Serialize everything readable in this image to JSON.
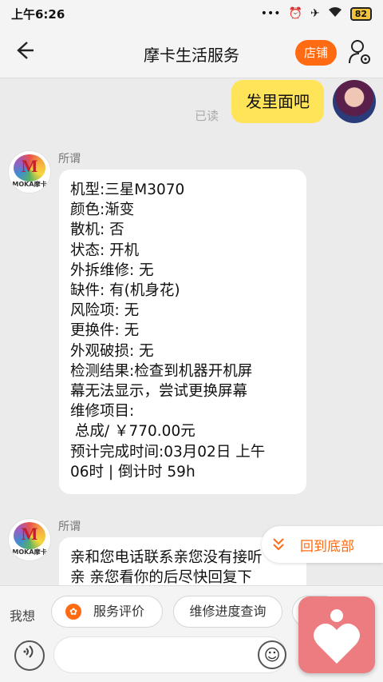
{
  "status_bar": {
    "time": "上午6:26",
    "icons": [
      "more-dots-icon",
      "alarm-icon",
      "airplane-icon",
      "wifi-icon"
    ],
    "battery": "82"
  },
  "header": {
    "back_icon": "back-arrow-icon",
    "title": "摩卡生活服务",
    "shop_button": "店铺",
    "user_icon": "user-settings-icon"
  },
  "chat": {
    "self_message": {
      "text": "发里面吧",
      "status": "已读"
    },
    "messages": [
      {
        "sender": "所谓",
        "avatar_text": "MOKA摩卡",
        "lines": [
          "机型:三星M3070",
          "颜色:渐变",
          "散机: 否",
          "状态: 开机",
          "外拆维修: 无",
          "缺件: 有(机身花)",
          "风险项: 无",
          "更换件: 无",
          "外观破损: 无",
          "检测结果:检查到机器开机屏",
          "幕无法显示，尝试更换屏幕",
          "维修项目:",
          " 总成/ ￥770.00元",
          "预计完成时间:03月02日 上午",
          "06时 | 倒计时 59h"
        ]
      },
      {
        "sender": "所谓",
        "avatar_text": "MOKA摩卡",
        "lines": [
          "亲和您电话联系亲您没有接听",
          "亲 亲您看你的后尽快回复下"
        ]
      }
    ],
    "scroll_to_bottom": "回到底部"
  },
  "quick_bar": {
    "label": "我想",
    "chips": [
      "服务评价",
      "维修进度查询"
    ]
  },
  "input_bar": {
    "voice_icon": "voice-icon",
    "emoji_icon": "emoji-icon"
  },
  "colors": {
    "accent": "#ff6a13",
    "self_bubble": "#ffe459",
    "background": "#ebebeb",
    "float_button": "#ec7c80"
  }
}
